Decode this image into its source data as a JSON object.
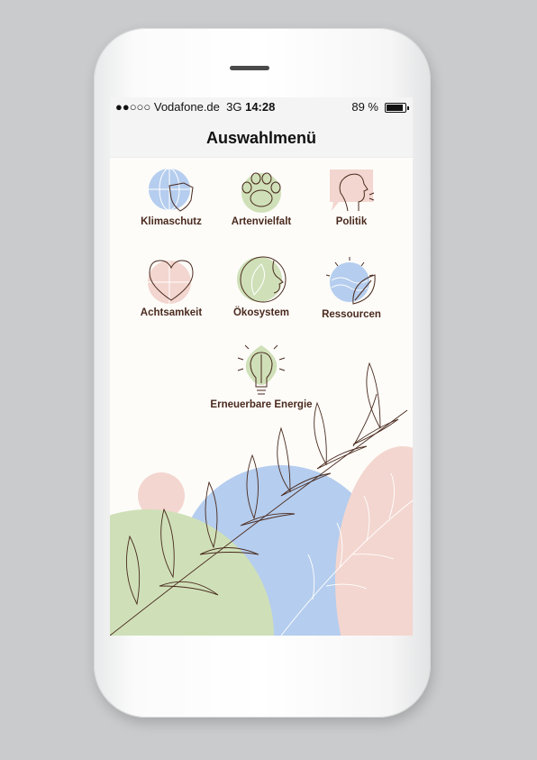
{
  "status": {
    "carrier": "●●○○○ Vodafone.de",
    "network": "3G",
    "time": "14:28",
    "battery": "89 %"
  },
  "nav": {
    "title": "Auswahlmenü"
  },
  "menu": [
    {
      "label": "Klimaschutz",
      "icon": "globe-shield-icon"
    },
    {
      "label": "Artenvielfalt",
      "icon": "paw-icon"
    },
    {
      "label": "Politik",
      "icon": "speaking-head-icon"
    },
    {
      "label": "Achtsamkeit",
      "icon": "heart-icon"
    },
    {
      "label": "Ökosystem",
      "icon": "ecosystem-icon"
    },
    {
      "label": "Ressourcen",
      "icon": "sun-leaf-icon"
    },
    {
      "label": "Erneuerbare Energie",
      "icon": "lightbulb-leaf-icon"
    }
  ],
  "colors": {
    "blue": "#b5cdee",
    "green": "#cfe0b8",
    "pink": "#f3d6cf",
    "line": "#4a2a1e"
  }
}
